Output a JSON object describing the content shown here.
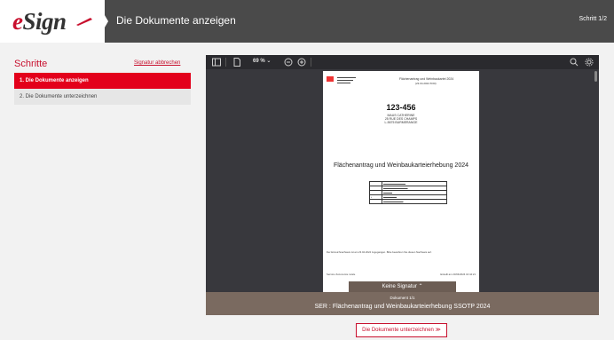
{
  "header": {
    "logo_e": "e",
    "logo_rest": "Sign",
    "title": "Die Dokumente anzeigen",
    "step_counter": "Schritt 1/2"
  },
  "sidebar": {
    "title": "Schritte",
    "abort_link": "Signatur abbrechen",
    "steps": [
      {
        "label": "1. Die Dokumente anzeigen",
        "active": true
      },
      {
        "label": "2. Die Dokumente unterzeichnen",
        "active": false
      }
    ]
  },
  "viewer": {
    "zoom": "69 %",
    "page": {
      "header_text": "Flächenantrag und Weinbaukartei 2024",
      "header_sub": "(23.04.2024 8:00)",
      "number": "123-456",
      "address": [
        "MAUS CATHERINE",
        "25 RUE DES CHAMPS",
        "L-5675 BURMERANGE"
      ],
      "title": "Flächenantrag und Weinbaukarteierhebung 2024",
      "footer_text": "Der Einreichnachweis ist am 23.04.2024 zugegangen. Bitte bewahren Sie diesen Nachweis auf.",
      "footer_left": "Service d'économie rurale",
      "footer_right": "Erstellt am 23/04/2024 10:44:21"
    },
    "signature_bar": "Keine Signatur  ⌃",
    "doc_count": "Dokument 1/1",
    "doc_name": "SER : Flächenantrag und Weinbaukarteierhebung SSOTP 2024"
  },
  "actions": {
    "sign_button": "Die Dokumente unterzeichnen  ≫"
  },
  "colors": {
    "accent": "#c8102e",
    "header_bg": "#4a4a4a",
    "viewer_bg": "#38383d",
    "docbar_bg": "#7a6a60"
  }
}
